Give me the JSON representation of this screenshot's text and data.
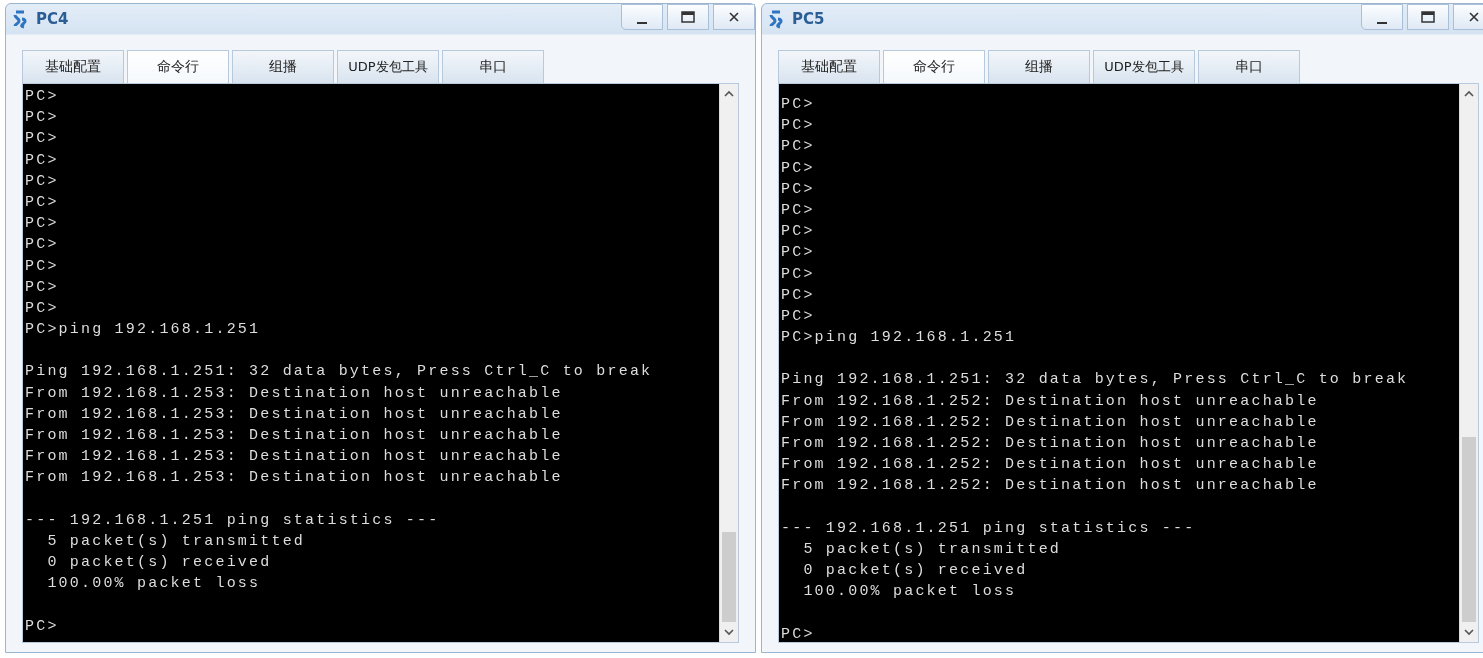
{
  "windows": [
    {
      "title": "PC4",
      "tabs": [
        {
          "label": "基础配置",
          "selected": false
        },
        {
          "label": "命令行",
          "selected": true
        },
        {
          "label": "组播",
          "selected": false
        },
        {
          "label": "UDP发包工具",
          "selected": false
        },
        {
          "label": "串口",
          "selected": false
        }
      ],
      "lines": [
        {
          "kind": "text",
          "text": "PC>"
        },
        {
          "kind": "text",
          "text": "PC>"
        },
        {
          "kind": "text",
          "text": "PC>"
        },
        {
          "kind": "text",
          "text": "PC>"
        },
        {
          "kind": "text",
          "text": "PC>"
        },
        {
          "kind": "text",
          "text": "PC>"
        },
        {
          "kind": "text",
          "text": "PC>"
        },
        {
          "kind": "text",
          "text": "PC>"
        },
        {
          "kind": "text",
          "text": "PC>"
        },
        {
          "kind": "text",
          "text": "PC>"
        },
        {
          "kind": "text",
          "text": "PC>"
        },
        {
          "kind": "text",
          "text": "PC>ping 192.168.1.251"
        },
        {
          "kind": "blank"
        },
        {
          "kind": "text",
          "text": "Ping 192.168.1.251: 32 data bytes, Press Ctrl_C to break"
        },
        {
          "kind": "text",
          "text": "From 192.168.1.253: Destination host unreachable"
        },
        {
          "kind": "text",
          "text": "From 192.168.1.253: Destination host unreachable"
        },
        {
          "kind": "text",
          "text": "From 192.168.1.253: Destination host unreachable"
        },
        {
          "kind": "text",
          "text": "From 192.168.1.253: Destination host unreachable"
        },
        {
          "kind": "text",
          "text": "From 192.168.1.253: Destination host unreachable"
        },
        {
          "kind": "blank"
        },
        {
          "kind": "text",
          "text": "--- 192.168.1.251 ping statistics ---"
        },
        {
          "kind": "text",
          "text": "  5 packet(s) transmitted"
        },
        {
          "kind": "text",
          "text": "  0 packet(s) received"
        },
        {
          "kind": "text",
          "text": "  100.00% packet loss"
        },
        {
          "kind": "blank"
        },
        {
          "kind": "text",
          "text": "PC>"
        }
      ]
    },
    {
      "title": "PC5",
      "tabs": [
        {
          "label": "基础配置",
          "selected": false
        },
        {
          "label": "命令行",
          "selected": true
        },
        {
          "label": "组播",
          "selected": false
        },
        {
          "label": "UDP发包工具",
          "selected": false
        },
        {
          "label": "串口",
          "selected": false
        }
      ],
      "lines": [
        {
          "kind": "text",
          "text": "PC>"
        },
        {
          "kind": "text",
          "text": "PC>"
        },
        {
          "kind": "text",
          "text": "PC>"
        },
        {
          "kind": "text",
          "text": "PC>"
        },
        {
          "kind": "text",
          "text": "PC>"
        },
        {
          "kind": "text",
          "text": "PC>"
        },
        {
          "kind": "text",
          "text": "PC>"
        },
        {
          "kind": "text",
          "text": "PC>"
        },
        {
          "kind": "text",
          "text": "PC>"
        },
        {
          "kind": "text",
          "text": "PC>"
        },
        {
          "kind": "text",
          "text": "PC>"
        },
        {
          "kind": "text",
          "text": "PC>ping 192.168.1.251"
        },
        {
          "kind": "blank"
        },
        {
          "kind": "text",
          "text": "Ping 192.168.1.251: 32 data bytes, Press Ctrl_C to break"
        },
        {
          "kind": "text",
          "text": "From 192.168.1.252: Destination host unreachable"
        },
        {
          "kind": "text",
          "text": "From 192.168.1.252: Destination host unreachable"
        },
        {
          "kind": "text",
          "text": "From 192.168.1.252: Destination host unreachable"
        },
        {
          "kind": "text",
          "text": "From 192.168.1.252: Destination host unreachable"
        },
        {
          "kind": "text",
          "text": "From 192.168.1.252: Destination host unreachable"
        },
        {
          "kind": "blank"
        },
        {
          "kind": "text",
          "text": "--- 192.168.1.251 ping statistics ---"
        },
        {
          "kind": "text",
          "text": "  5 packet(s) transmitted"
        },
        {
          "kind": "text",
          "text": "  0 packet(s) received"
        },
        {
          "kind": "text",
          "text": "  100.00% packet loss"
        },
        {
          "kind": "blank"
        },
        {
          "kind": "text",
          "text": "PC>"
        }
      ]
    }
  ]
}
